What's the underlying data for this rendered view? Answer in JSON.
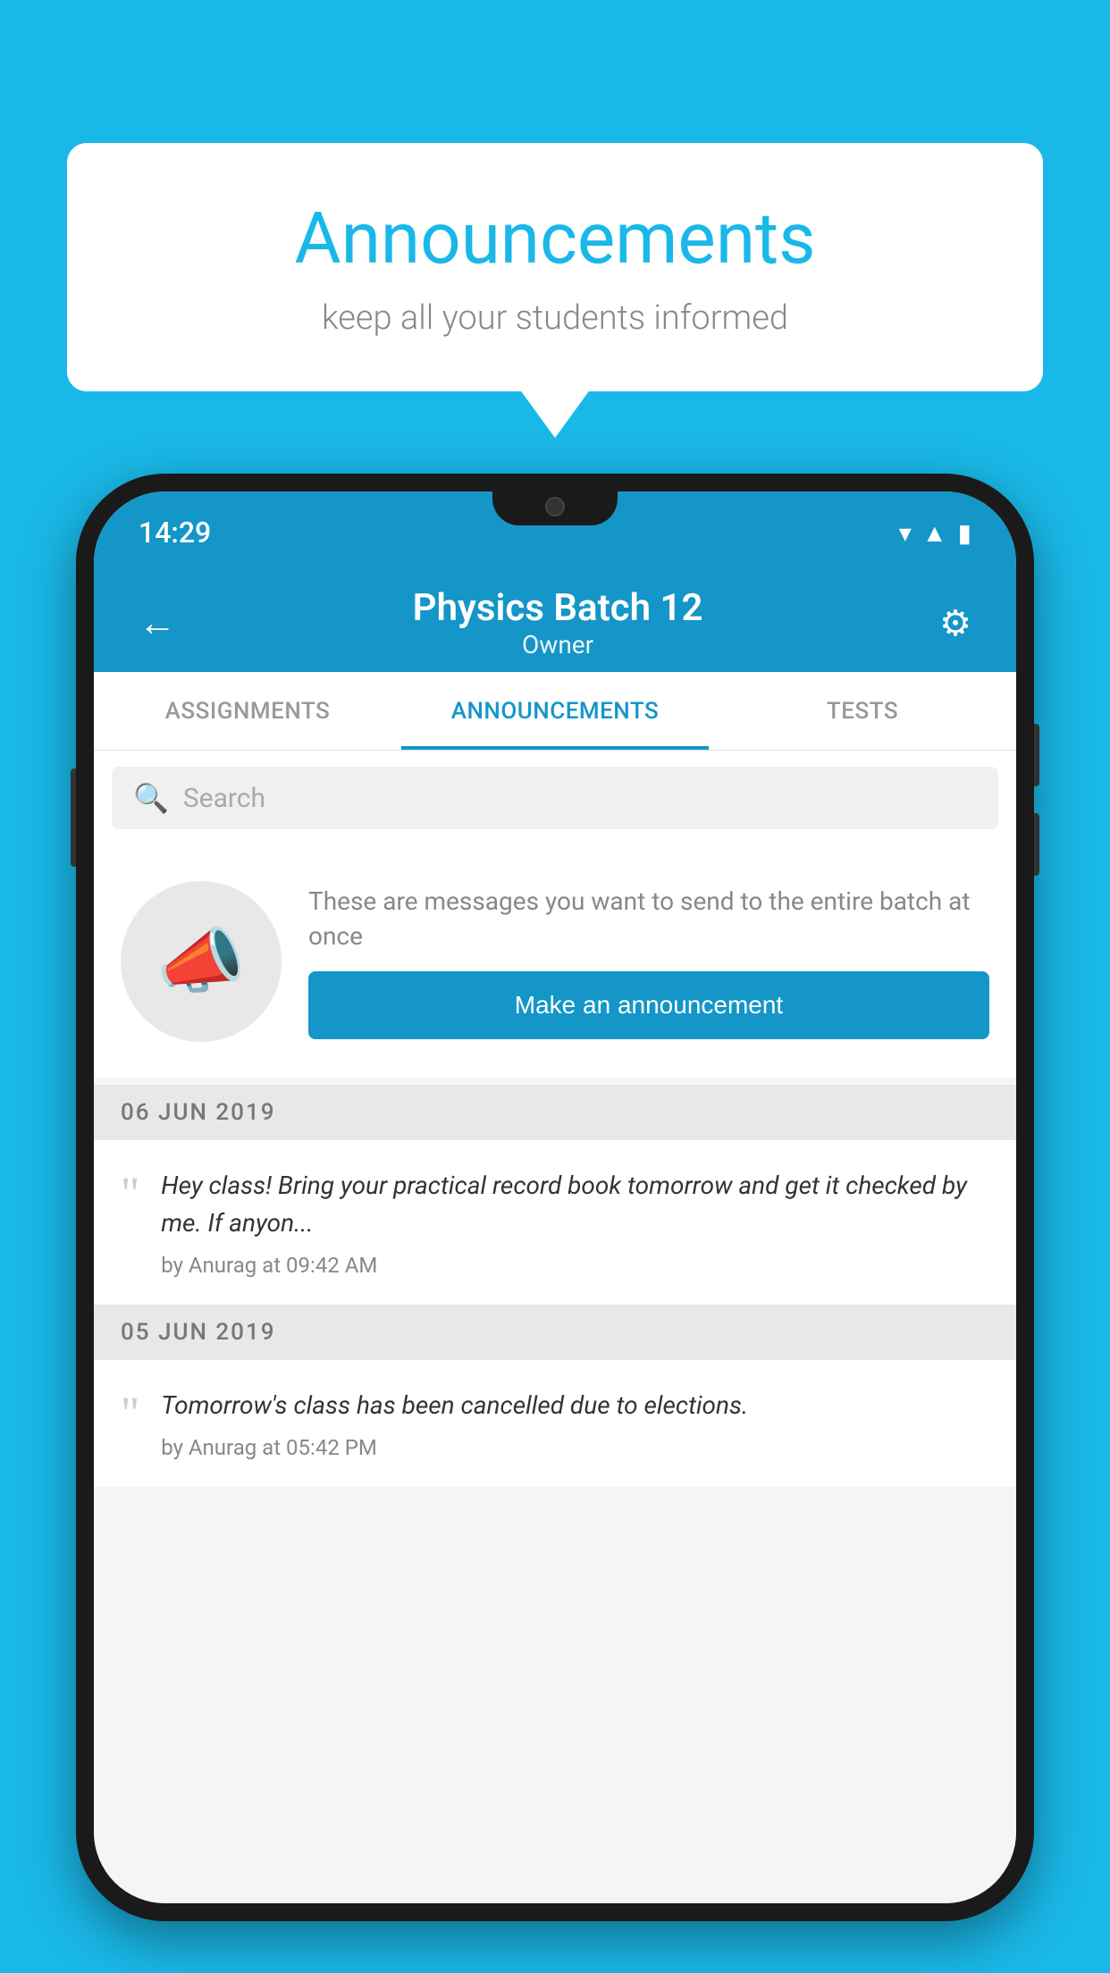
{
  "background_color": "#1ab8e8",
  "speech_bubble": {
    "title": "Announcements",
    "subtitle": "keep all your students informed"
  },
  "phone": {
    "status_bar": {
      "time": "14:29"
    },
    "header": {
      "title": "Physics Batch 12",
      "subtitle": "Owner",
      "back_label": "←",
      "settings_label": "⚙"
    },
    "tabs": [
      {
        "label": "ASSIGNMENTS",
        "active": false
      },
      {
        "label": "ANNOUNCEMENTS",
        "active": true
      },
      {
        "label": "TESTS",
        "active": false
      }
    ],
    "search": {
      "placeholder": "Search"
    },
    "empty_state": {
      "description": "These are messages you want to send to the entire batch at once",
      "button_label": "Make an announcement"
    },
    "announcements": [
      {
        "date": "06  JUN  2019",
        "text": "Hey class! Bring your practical record book tomorrow and get it checked by me. If anyon...",
        "meta": "by Anurag at 09:42 AM"
      },
      {
        "date": "05  JUN  2019",
        "text": "Tomorrow's class has been cancelled due to elections.",
        "meta": "by Anurag at 05:42 PM"
      }
    ]
  }
}
